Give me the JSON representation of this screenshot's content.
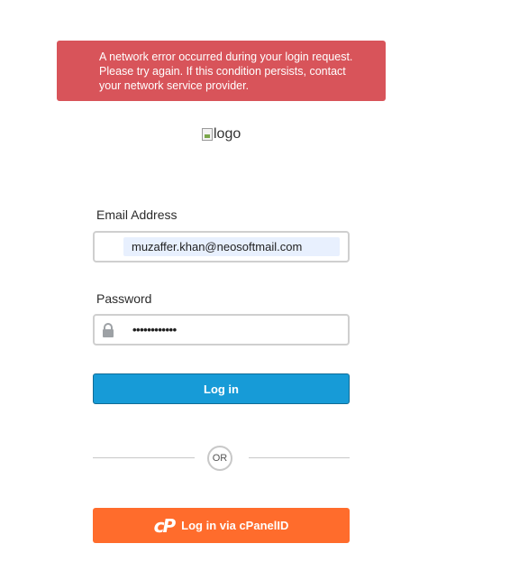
{
  "error": {
    "message": "A network error occurred during your login request. Please try again. If this condition persists, contact your network service provider."
  },
  "logo": {
    "alt_text": "logo"
  },
  "form": {
    "email_label": "Email Address",
    "email_value": "muzaffer.khan@neosoftmail.com",
    "password_label": "Password",
    "password_value": "••••••••••••",
    "login_label": "Log in",
    "or_label": "OR",
    "cpanel_label": "Log in via cPanelID"
  },
  "colors": {
    "error_bg": "#d8545a",
    "login_bg": "#179bd7",
    "cpanel_bg": "#ff6c2c"
  },
  "icons": [
    "broken-image-icon",
    "lock-icon",
    "cpanel-logo-icon"
  ]
}
